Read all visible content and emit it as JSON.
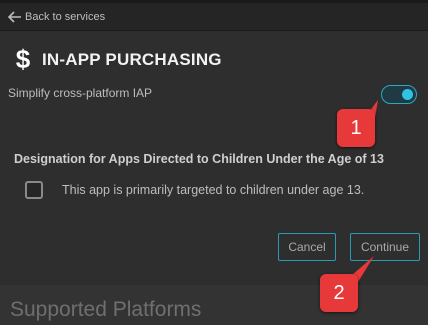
{
  "nav": {
    "back_label": "Back to services"
  },
  "header": {
    "icon": "dollar-icon",
    "title": "IN-APP PURCHASING"
  },
  "iap": {
    "subtitle": "Simplify cross-platform IAP",
    "toggle_on": true
  },
  "coppa": {
    "heading": "Designation for Apps Directed to Children Under the Age of 13",
    "checkbox_label": "This app is primarily targeted to children under age 13.",
    "checked": false
  },
  "actions": {
    "cancel_label": "Cancel",
    "continue_label": "Continue"
  },
  "next_section": {
    "title": "Supported Platforms"
  },
  "annotations": [
    {
      "label": "1"
    },
    {
      "label": "2"
    }
  ],
  "colors": {
    "accent": "#2fc3e3",
    "badge": "#e8393a",
    "background": "#2e2e2e"
  }
}
